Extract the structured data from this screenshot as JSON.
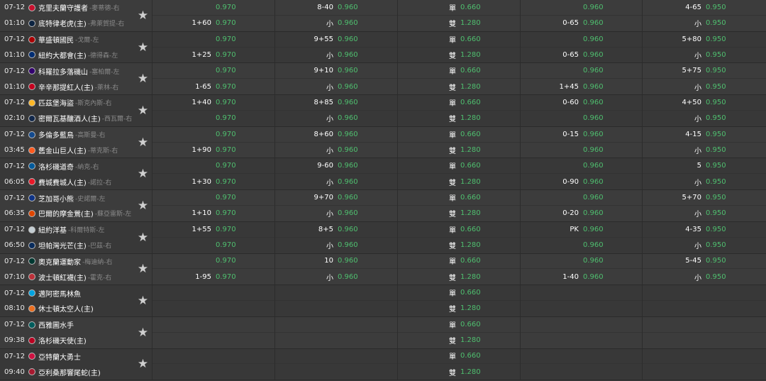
{
  "games": [
    {
      "teams": [
        {
          "time": "07-12",
          "name": "克里夫蘭守護者",
          "pitcher": "-麥蒂德-右",
          "color": "#c8102e"
        },
        {
          "time": "01:10",
          "name": "底特律老虎(主)",
          "pitcher": "-弗萊賀提-右",
          "color": "#0c2340"
        }
      ],
      "cols": [
        [
          [
            "",
            "0.970"
          ],
          [
            "1+60",
            "0.970"
          ]
        ],
        [
          [
            "8-40",
            "0.960"
          ],
          [
            "小",
            "0.960"
          ]
        ],
        [
          [
            "單",
            "0.660"
          ],
          [
            "雙",
            "1.280"
          ]
        ],
        [
          [
            "",
            "0.960"
          ],
          [
            "0-65",
            "0.960"
          ]
        ],
        [
          [
            "4-65",
            "0.950"
          ],
          [
            "小",
            "0.950"
          ]
        ]
      ]
    },
    {
      "teams": [
        {
          "time": "07-12",
          "name": "華盛頓國民",
          "pitcher": "-戈爾-左",
          "color": "#ab0003"
        },
        {
          "time": "01:10",
          "name": "紐約大都會(主)",
          "pitcher": "-德得森-左",
          "color": "#002d72"
        }
      ],
      "cols": [
        [
          [
            "",
            "0.970"
          ],
          [
            "1+25",
            "0.970"
          ]
        ],
        [
          [
            "9+55",
            "0.960"
          ],
          [
            "小",
            "0.960"
          ]
        ],
        [
          [
            "單",
            "0.660"
          ],
          [
            "雙",
            "1.280"
          ]
        ],
        [
          [
            "",
            "0.960"
          ],
          [
            "0-65",
            "0.960"
          ]
        ],
        [
          [
            "5+80",
            "0.950"
          ],
          [
            "小",
            "0.950"
          ]
        ]
      ]
    },
    {
      "teams": [
        {
          "time": "07-12",
          "name": "科羅拉多落磯山",
          "pitcher": "-塞柏爾-左",
          "color": "#33006f"
        },
        {
          "time": "01:10",
          "name": "辛辛那提紅人(主)",
          "pitcher": "-萊林-右",
          "color": "#c6011f"
        }
      ],
      "cols": [
        [
          [
            "",
            "0.970"
          ],
          [
            "1-65",
            "0.970"
          ]
        ],
        [
          [
            "9+10",
            "0.960"
          ],
          [
            "小",
            "0.960"
          ]
        ],
        [
          [
            "單",
            "0.660"
          ],
          [
            "雙",
            "1.280"
          ]
        ],
        [
          [
            "",
            "0.960"
          ],
          [
            "1+45",
            "0.960"
          ]
        ],
        [
          [
            "5+75",
            "0.950"
          ],
          [
            "小",
            "0.950"
          ]
        ]
      ]
    },
    {
      "teams": [
        {
          "time": "07-12",
          "name": "匹茲堡海盜",
          "pitcher": "-斯克內斯-右",
          "color": "#fdb827"
        },
        {
          "time": "02:10",
          "name": "密爾瓦基釀酒人(主)",
          "pitcher": "-西瓦爾-右",
          "color": "#12284b"
        }
      ],
      "cols": [
        [
          [
            "1+40",
            "0.970"
          ],
          [
            "",
            "0.970"
          ]
        ],
        [
          [
            "8+85",
            "0.960"
          ],
          [
            "小",
            "0.960"
          ]
        ],
        [
          [
            "單",
            "0.660"
          ],
          [
            "雙",
            "1.280"
          ]
        ],
        [
          [
            "0-60",
            "0.960"
          ],
          [
            "",
            "0.960"
          ]
        ],
        [
          [
            "4+50",
            "0.950"
          ],
          [
            "小",
            "0.950"
          ]
        ]
      ]
    },
    {
      "teams": [
        {
          "time": "07-12",
          "name": "多倫多藍鳥",
          "pitcher": "-高斯曼-右",
          "color": "#134a8e"
        },
        {
          "time": "03:45",
          "name": "舊金山巨人(主)",
          "pitcher": "-蒂克斯-右",
          "color": "#fd5a1e"
        }
      ],
      "cols": [
        [
          [
            "",
            "0.970"
          ],
          [
            "1+90",
            "0.970"
          ]
        ],
        [
          [
            "8+60",
            "0.960"
          ],
          [
            "小",
            "0.960"
          ]
        ],
        [
          [
            "單",
            "0.660"
          ],
          [
            "雙",
            "1.280"
          ]
        ],
        [
          [
            "0-15",
            "0.960"
          ],
          [
            "",
            "0.960"
          ]
        ],
        [
          [
            "4-15",
            "0.950"
          ],
          [
            "小",
            "0.950"
          ]
        ]
      ]
    },
    {
      "teams": [
        {
          "time": "07-12",
          "name": "洛杉磯道奇",
          "pitcher": "-納克-右",
          "color": "#005a9c"
        },
        {
          "time": "06:05",
          "name": "費城費城人(主)",
          "pitcher": "-諾拉-右",
          "color": "#e81828"
        }
      ],
      "cols": [
        [
          [
            "",
            "0.970"
          ],
          [
            "1+30",
            "0.970"
          ]
        ],
        [
          [
            "9-60",
            "0.960"
          ],
          [
            "小",
            "0.960"
          ]
        ],
        [
          [
            "單",
            "0.660"
          ],
          [
            "雙",
            "1.280"
          ]
        ],
        [
          [
            "",
            "0.960"
          ],
          [
            "0-90",
            "0.960"
          ]
        ],
        [
          [
            "5",
            "0.950"
          ],
          [
            "小",
            "0.950"
          ]
        ]
      ]
    },
    {
      "teams": [
        {
          "time": "07-12",
          "name": "芝加哥小熊",
          "pitcher": "-史諾爾-左",
          "color": "#0e3386"
        },
        {
          "time": "06:35",
          "name": "巴爾的摩金鶯(主)",
          "pitcher": "-蘇亞雷斯-左",
          "color": "#df4601"
        }
      ],
      "cols": [
        [
          [
            "",
            "0.970"
          ],
          [
            "1+10",
            "0.970"
          ]
        ],
        [
          [
            "9+70",
            "0.960"
          ],
          [
            "小",
            "0.960"
          ]
        ],
        [
          [
            "單",
            "0.660"
          ],
          [
            "雙",
            "1.280"
          ]
        ],
        [
          [
            "",
            "0.960"
          ],
          [
            "0-20",
            "0.960"
          ]
        ],
        [
          [
            "5+70",
            "0.950"
          ],
          [
            "小",
            "0.950"
          ]
        ]
      ]
    },
    {
      "teams": [
        {
          "time": "07-12",
          "name": "紐約洋基",
          "pitcher": "-科爾特斯-左",
          "color": "#c4ced3"
        },
        {
          "time": "06:50",
          "name": "坦帕灣光芒(主)",
          "pitcher": "-巴茲-右",
          "color": "#092c5c"
        }
      ],
      "cols": [
        [
          [
            "1+55",
            "0.970"
          ],
          [
            "",
            "0.970"
          ]
        ],
        [
          [
            "8+5",
            "0.960"
          ],
          [
            "小",
            "0.960"
          ]
        ],
        [
          [
            "單",
            "0.660"
          ],
          [
            "雙",
            "1.280"
          ]
        ],
        [
          [
            "PK",
            "0.960"
          ],
          [
            "",
            "0.960"
          ]
        ],
        [
          [
            "4-35",
            "0.950"
          ],
          [
            "小",
            "0.950"
          ]
        ]
      ]
    },
    {
      "teams": [
        {
          "time": "07-12",
          "name": "奧克蘭運動家",
          "pitcher": "-梅迪納-右",
          "color": "#003831"
        },
        {
          "time": "07:10",
          "name": "波士頓紅襪(主)",
          "pitcher": "-霍克-右",
          "color": "#bd3039"
        }
      ],
      "cols": [
        [
          [
            "",
            "0.970"
          ],
          [
            "1-95",
            "0.970"
          ]
        ],
        [
          [
            "10",
            "0.960"
          ],
          [
            "小",
            "0.960"
          ]
        ],
        [
          [
            "單",
            "0.660"
          ],
          [
            "雙",
            "1.280"
          ]
        ],
        [
          [
            "",
            "0.960"
          ],
          [
            "1-40",
            "0.960"
          ]
        ],
        [
          [
            "5-45",
            "0.950"
          ],
          [
            "小",
            "0.950"
          ]
        ]
      ]
    },
    {
      "teams": [
        {
          "time": "07-12",
          "name": "邁阿密馬林魚",
          "pitcher": "",
          "color": "#00a3e0"
        },
        {
          "time": "08:10",
          "name": "休士頓太空人(主)",
          "pitcher": "",
          "color": "#eb6e1f"
        }
      ],
      "cols": [
        [
          [
            "",
            ""
          ],
          [
            "",
            ""
          ]
        ],
        [
          [
            "",
            ""
          ],
          [
            "",
            ""
          ]
        ],
        [
          [
            "單",
            "0.660"
          ],
          [
            "雙",
            "1.280"
          ]
        ],
        [
          [
            "",
            ""
          ],
          [
            "",
            ""
          ]
        ],
        [
          [
            "",
            ""
          ],
          [
            "",
            ""
          ]
        ]
      ]
    },
    {
      "teams": [
        {
          "time": "07-12",
          "name": "西雅圖水手",
          "pitcher": "",
          "color": "#005c5c"
        },
        {
          "time": "09:38",
          "name": "洛杉磯天使(主)",
          "pitcher": "",
          "color": "#ba0021"
        }
      ],
      "cols": [
        [
          [
            "",
            ""
          ],
          [
            "",
            ""
          ]
        ],
        [
          [
            "",
            ""
          ],
          [
            "",
            ""
          ]
        ],
        [
          [
            "單",
            "0.660"
          ],
          [
            "雙",
            "1.280"
          ]
        ],
        [
          [
            "",
            ""
          ],
          [
            "",
            ""
          ]
        ],
        [
          [
            "",
            ""
          ],
          [
            "",
            ""
          ]
        ]
      ]
    },
    {
      "teams": [
        {
          "time": "07-12",
          "name": "亞特蘭大勇士",
          "pitcher": "",
          "color": "#ce1141"
        },
        {
          "time": "09:40",
          "name": "亞利桑那響尾蛇(主)",
          "pitcher": "",
          "color": "#a71930"
        }
      ],
      "cols": [
        [
          [
            "",
            ""
          ],
          [
            "",
            ""
          ]
        ],
        [
          [
            "",
            ""
          ],
          [
            "",
            ""
          ]
        ],
        [
          [
            "單",
            "0.660"
          ],
          [
            "雙",
            "1.280"
          ]
        ],
        [
          [
            "",
            ""
          ],
          [
            "",
            ""
          ]
        ],
        [
          [
            "",
            ""
          ],
          [
            "",
            ""
          ]
        ]
      ]
    }
  ],
  "icons": {
    "favorite": "star-icon"
  },
  "colors": {
    "odds": "#4fbf6f",
    "background": "#3a3a3a"
  }
}
